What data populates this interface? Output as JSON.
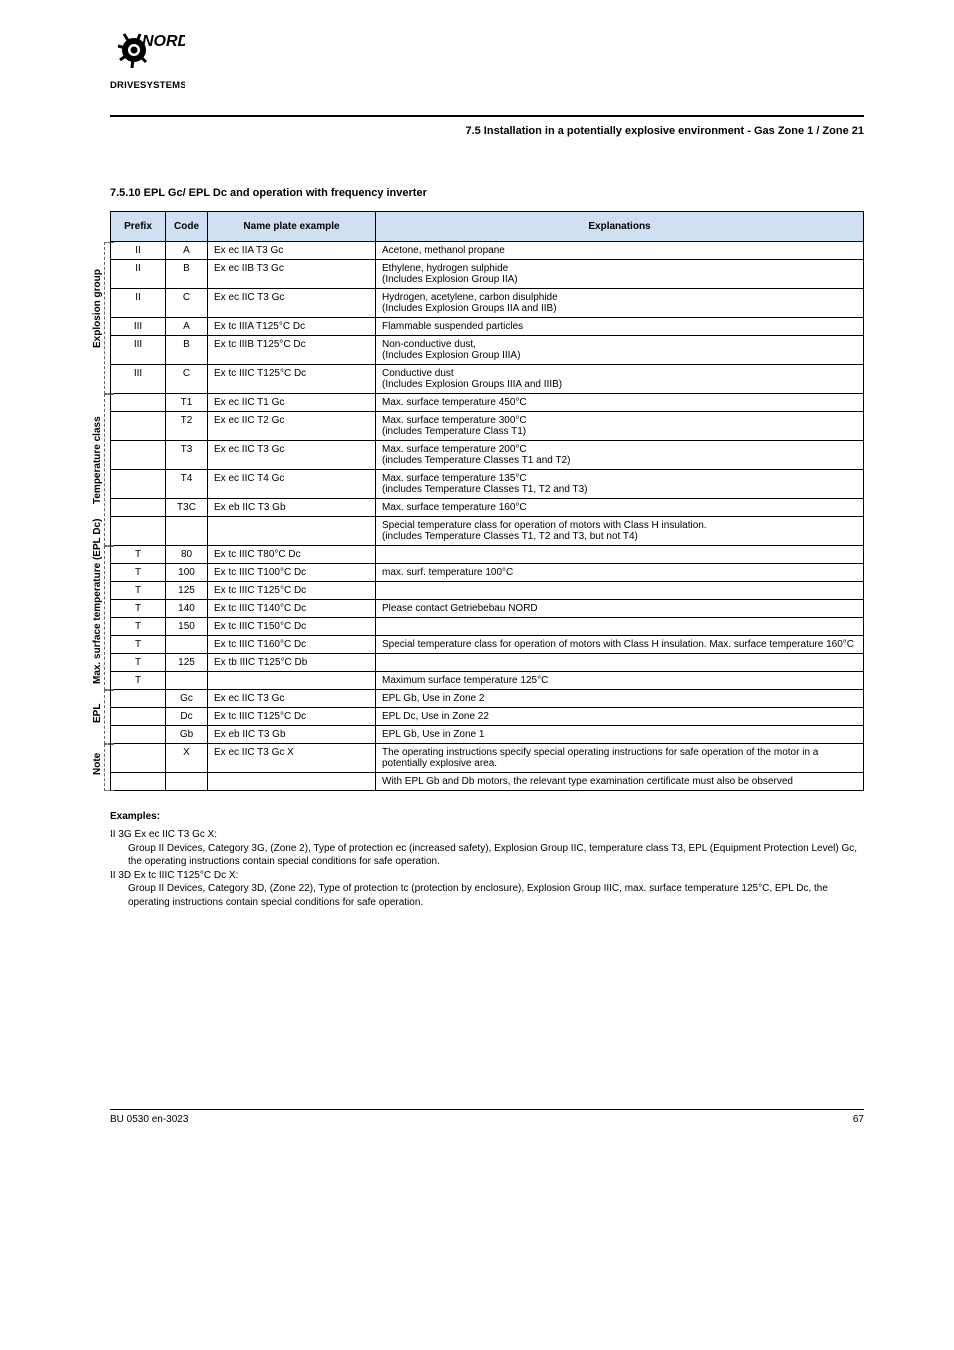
{
  "logo": {
    "top": "NORD",
    "sub": "DRIVESYSTEMS"
  },
  "section_title": "7.5 Installation in a potentially explosive environment - Gas Zone 1 / Zone 21",
  "sub_heading": "7.5.10 EPL Gc/ EPL Dc and operation with frequency inverter",
  "table": {
    "headers": [
      "Prefix",
      "Code",
      "Name plate example",
      "Explanations"
    ],
    "col3_header_colspan": 2,
    "groups": [
      {
        "label": "Explosion group",
        "rows": [
          {
            "c0": "II",
            "c1": "A",
            "c2": "Ex ec IIA T3 Gc",
            "c3": "Acetone, methanol propane",
            "top": "solid"
          },
          {
            "c0": "II",
            "c1": "B",
            "c2": "Ex ec IIB T3 Gc",
            "c3": "Ethylene, hydrogen sulphide\n(Includes Explosion Group IIA)",
            "top": "dotted"
          },
          {
            "c0": "II",
            "c1": "C",
            "c2": "Ex ec IIC T3 Gc",
            "c3": "Hydrogen, acetylene, carbon disulphide\n(Includes Explosion Groups IIA and IIB)",
            "top": "solid"
          },
          {
            "c0": "III",
            "c1": "A",
            "c2": "Ex tc IIIA T125°C Dc",
            "c3": "Flammable suspended particles",
            "top": "solid"
          },
          {
            "c0": "III",
            "c1": "B",
            "c2": "Ex tc IIIB T125°C Dc",
            "c3": "Non-conductive dust,\n(Includes Explosion Group IIIA)",
            "top": "dotted"
          },
          {
            "c0": "III",
            "c1": "C",
            "c2": "Ex tc IIIC T125°C Dc",
            "c3": "Conductive dust\n(Includes Explosion Groups IIIA and IIIB)",
            "top": "solid"
          }
        ]
      },
      {
        "label": "Temperature class",
        "rows": [
          {
            "c0": "",
            "c1": "T1",
            "c2": "Ex ec IIC T1 Gc",
            "c3": "Max. surface temperature 450°C",
            "top": "solid"
          },
          {
            "c0": "",
            "c1": "T2",
            "c2": "Ex ec IIC T2 Gc",
            "c3": "Max. surface temperature 300°C\n(includes Temperature Class T1)",
            "top": "dotted"
          },
          {
            "c0": "",
            "c1": "T3",
            "c2": "Ex ec IIC T3 Gc",
            "c3": "Max. surface temperature 200°C\n(includes Temperature Classes T1 and T2)",
            "top": "solid"
          },
          {
            "c0": "",
            "c1": "T4",
            "c2": "Ex ec IIC T4 Gc",
            "c3": "Max. surface temperature 135°C\n(includes Temperature Classes T1, T2 and T3)",
            "top": "dotted"
          },
          {
            "c0": "",
            "c1": "T3C",
            "c2": "Ex eb IIC T3 Gb",
            "c3": "Max. surface temperature 160°C",
            "top": "solid"
          },
          {
            "c0": "",
            "c1": "",
            "c2": "",
            "c3": "Special temperature class for operation of motors with Class H insulation.\n(includes Temperature Classes T1, T2 and T3, but not T4)",
            "top": "dotted"
          }
        ]
      },
      {
        "label": "Max. surface temperature (EPL Dc)",
        "rows": [
          {
            "c0": "T",
            "c1": "80",
            "c2": "Ex tc IIIC T80°C Dc",
            "c3": "",
            "top": "solid"
          },
          {
            "c0": "T",
            "c1": "100",
            "c2": "Ex tc IIIC T100°C Dc",
            "c3": "max. surf. temperature 100°C",
            "top": "dotted"
          },
          {
            "c0": "T",
            "c1": "125",
            "c2": "Ex tc IIIC T125°C Dc",
            "c3": "",
            "top": "solid"
          },
          {
            "c0": "T",
            "c1": "140",
            "c2": "Ex tc IIIC T140°C Dc",
            "c3": "Please contact Getriebebau NORD",
            "top": "dotted"
          },
          {
            "c0": "T",
            "c1": "150",
            "c2": "Ex tc IIIC T150°C Dc",
            "c3": "",
            "top": "solid"
          },
          {
            "c0": "T",
            "c1": "",
            "c2": "Ex tc IIIC T160°C Dc",
            "c3": "Special temperature class for operation of motors with Class H insulation. Max. surface temperature 160°C",
            "top": "dotted"
          },
          {
            "c0": "T",
            "c1": "125",
            "c2": "Ex tb IIIC T125°C Db",
            "c3": "",
            "top": "solid"
          },
          {
            "c0": "T",
            "c1": "",
            "c2": "",
            "c3": "Maximum surface temperature 125°C",
            "top": "dotted"
          }
        ]
      },
      {
        "label": "EPL",
        "rows": [
          {
            "c0": "",
            "c1": "Gc",
            "c2": "Ex ec IIC T3 Gc",
            "c3": "EPL Gb, Use in Zone 2",
            "top": "solid"
          },
          {
            "c0": "",
            "c1": "Dc",
            "c2": "Ex tc IIIC T125°C Dc",
            "c3": "EPL Dc, Use in Zone 22",
            "top": "dotted"
          },
          {
            "c0": "",
            "c1": "Gb",
            "c2": "Ex eb IIC T3 Gb",
            "c3": "EPL Gb, Use in Zone 1",
            "top": "solid"
          }
        ]
      },
      {
        "label": "Note",
        "rows": [
          {
            "c0": "",
            "c1": "X",
            "c2": "Ex ec IIC T3 Gc X",
            "c3_split": [
              "The operating instructions specify special operating instructions for safe operation of the motor in a potentially explosive area.",
              "With EPL Gb and Db motors, the relevant type examination certificate must also be observed"
            ],
            "top": "solid"
          }
        ]
      }
    ]
  },
  "examples": {
    "heading": "Examples:",
    "lines": [
      "II  3G  Ex ec IIC T3 Gc X:",
      "    Group II Devices, Category 3G, (Zone 2), Type of protection ec (increased safety), Explosion Group IIC, temperature class T3, EPL (Equipment Protection Level) Gc, the operating instructions contain special conditions for safe operation.",
      "II  3D  Ex tc IIIC T125°C Dc X:",
      "    Group II Devices, Category 3D, (Zone 22), Type of protection tc (protection by enclosure), Explosion Group IIIC, max. surface temperature 125°C, EPL Dc, the operating instructions contain special conditions for safe operation."
    ]
  },
  "footer": {
    "left": "BU 0530 en-3023",
    "right": "67"
  }
}
